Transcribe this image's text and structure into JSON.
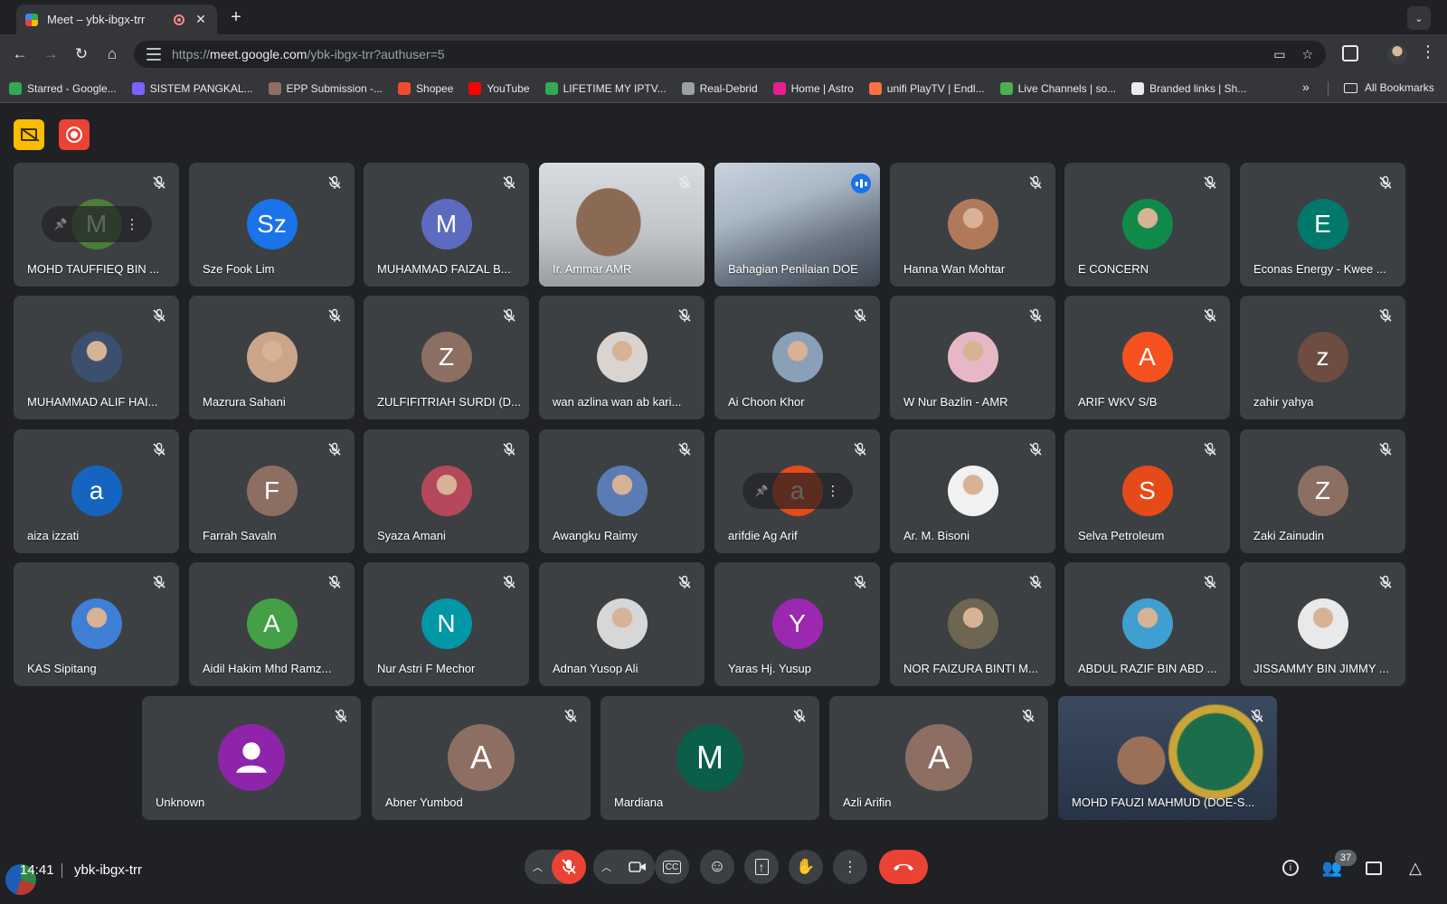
{
  "browser": {
    "tab_title": "Meet – ybk-ibgx-trr",
    "url_scheme": "https://",
    "url_host": "meet.google.com",
    "url_path": "/ybk-ibgx-trr?authuser=5",
    "new_tab": "+",
    "tab_search": "⌄"
  },
  "bookmarks": {
    "items": [
      {
        "label": "Starred - Google...",
        "color": "#34a853"
      },
      {
        "label": "SISTEM PANGKAL...",
        "color": "#7b61ff"
      },
      {
        "label": "EPP Submission -...",
        "color": "#8d6e63"
      },
      {
        "label": "Shopee",
        "color": "#ee4d2d"
      },
      {
        "label": "YouTube",
        "color": "#ff0000"
      },
      {
        "label": "LIFETIME MY IPTV...",
        "color": "#34a853"
      },
      {
        "label": "Real-Debrid",
        "color": "#9aa0a6"
      },
      {
        "label": "Home | Astro",
        "color": "#e91e8c"
      },
      {
        "label": "unifi PlayTV | Endl...",
        "color": "#ff7043"
      },
      {
        "label": "Live Channels | so...",
        "color": "#4caf50"
      },
      {
        "label": "Branded links | Sh...",
        "color": "#e8eaed"
      }
    ],
    "all_bookmarks": "All Bookmarks"
  },
  "meeting": {
    "time": "14:41",
    "code": "ybk-ibgx-trr",
    "people_count": "37"
  },
  "tiles": [
    {
      "name": "MOHD TAUFFIEQ BIN ...",
      "initial": "M",
      "color": "#4f7c3a",
      "hover": true
    },
    {
      "name": "Sze Fook Lim",
      "initial": "Sz",
      "color": "#1a73e8"
    },
    {
      "name": "MUHAMMAD FAIZAL B...",
      "initial": "M",
      "color": "#5c6bc0"
    },
    {
      "name": "Ir. Ammar AMR",
      "video": "ammar"
    },
    {
      "name": "Bahagian Penilaian DOE",
      "video": "room",
      "speaking": true
    },
    {
      "name": "Hanna Wan Mohtar",
      "photo": "#b07a5a"
    },
    {
      "name": "E CONCERN",
      "photo": "#0f8a4a"
    },
    {
      "name": "Econas Energy - Kwee ...",
      "initial": "E",
      "color": "#00796b"
    },
    {
      "name": "MUHAMMAD ALIF HAI...",
      "photo": "#3d4f6e"
    },
    {
      "name": "Mazrura Sahani",
      "photo": "#caa58a"
    },
    {
      "name": "ZULFIFITRIAH SURDI (D...",
      "initial": "Z",
      "color": "#8d6e63"
    },
    {
      "name": "wan azlina wan ab kari...",
      "photo": "#d9d4cf"
    },
    {
      "name": "Ai Choon Khor",
      "photo": "#8aa0b8"
    },
    {
      "name": "W Nur Bazlin - AMR",
      "photo": "#e8b7c6"
    },
    {
      "name": "ARIF WKV S/B",
      "initial": "A",
      "color": "#f4511e"
    },
    {
      "name": "zahir yahya",
      "initial": "z",
      "color": "#6d4c41"
    },
    {
      "name": "aiza izzati",
      "initial": "a",
      "color": "#1565c0"
    },
    {
      "name": "Farrah Savaln",
      "initial": "F",
      "color": "#8d6e63"
    },
    {
      "name": "Syaza Amani",
      "photo": "#b5485a"
    },
    {
      "name": "Awangku Raimy",
      "photo": "#5b7bb5"
    },
    {
      "name": "arifdie Ag Arif",
      "initial": "a",
      "color": "#e64a19",
      "hover": true
    },
    {
      "name": "Ar. M. Bisoni",
      "photo": "#f1f1f1"
    },
    {
      "name": "Selva Petroleum",
      "initial": "S",
      "color": "#e64a19"
    },
    {
      "name": "Zaki Zainudin",
      "initial": "Z",
      "color": "#8d6e63"
    },
    {
      "name": "KAS Sipitang",
      "photo": "#3f7fd6"
    },
    {
      "name": "Aidil Hakim Mhd Ramz...",
      "initial": "A",
      "color": "#43a047"
    },
    {
      "name": "Nur Astri F Mechor",
      "initial": "N",
      "color": "#0097a7"
    },
    {
      "name": "Adnan Yusop Ali",
      "photo": "#d7d7d7"
    },
    {
      "name": "Yaras Hj. Yusup",
      "initial": "Y",
      "color": "#9c27b0"
    },
    {
      "name": "NOR FAIZURA BINTI M...",
      "photo": "#6e6552"
    },
    {
      "name": "ABDUL RAZIF BIN ABD ...",
      "photo": "#3f9fd0"
    },
    {
      "name": "JISSAMMY BIN JIMMY ...",
      "photo": "#e9e9e9"
    },
    {
      "name": "Unknown",
      "initial": "",
      "color": "#8e24aa",
      "generic": true
    },
    {
      "name": "Abner Yumbod",
      "initial": "A",
      "color": "#8d6e63"
    },
    {
      "name": "Mardiana",
      "initial": "M",
      "color": "#0b5e4a"
    },
    {
      "name": "Azli Arifin",
      "initial": "A",
      "color": "#8d6e63"
    },
    {
      "name": "MOHD FAUZI MAHMUD (DOE-S...",
      "video": "fauzi"
    }
  ]
}
